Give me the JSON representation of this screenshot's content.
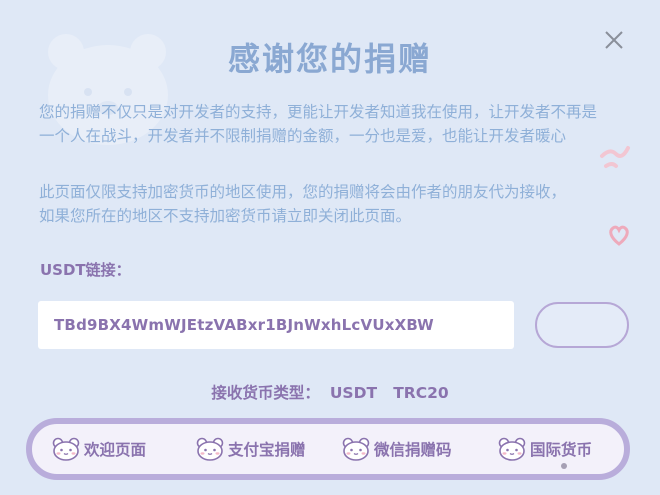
{
  "dialog": {
    "title": "感谢您的捐赠",
    "paragraph1": "您的捐赠不仅只是对开发者的支持，更能让开发者知道我在使用，让开发者不再是\n一个人在战斗，开发者并不限制捐赠的金额，一分也是爱，也能让开发者暖心",
    "paragraph2": "此页面仅限支持加密货币的地区使用，您的捐赠将会由作者的朋友代为接收，\n如果您所在的地区不支持加密货币请立即关闭此页面。",
    "link_label": "USDT链接：",
    "address": "TBd9BX4WmWJEtzVABxr1BJnWxhLcVUxXBW",
    "currency_label": "接收货币类型：",
    "currency_value": "USDT   TRC20"
  },
  "nav": {
    "items": [
      {
        "label": "欢迎页面"
      },
      {
        "label": "支付宝捐赠"
      },
      {
        "label": "微信捐赠码"
      },
      {
        "label": "国际货币"
      }
    ],
    "active_index": 3
  },
  "colors": {
    "background": "#dfe8f6",
    "title": "#8aa8d2",
    "body_text": "#8fb0d8",
    "accent_purple": "#8a73ae",
    "nav_border": "#b9addb"
  },
  "icons": {
    "close": "close-icon",
    "nav": "bear-face-icon",
    "decoration": "bear-decoration"
  }
}
